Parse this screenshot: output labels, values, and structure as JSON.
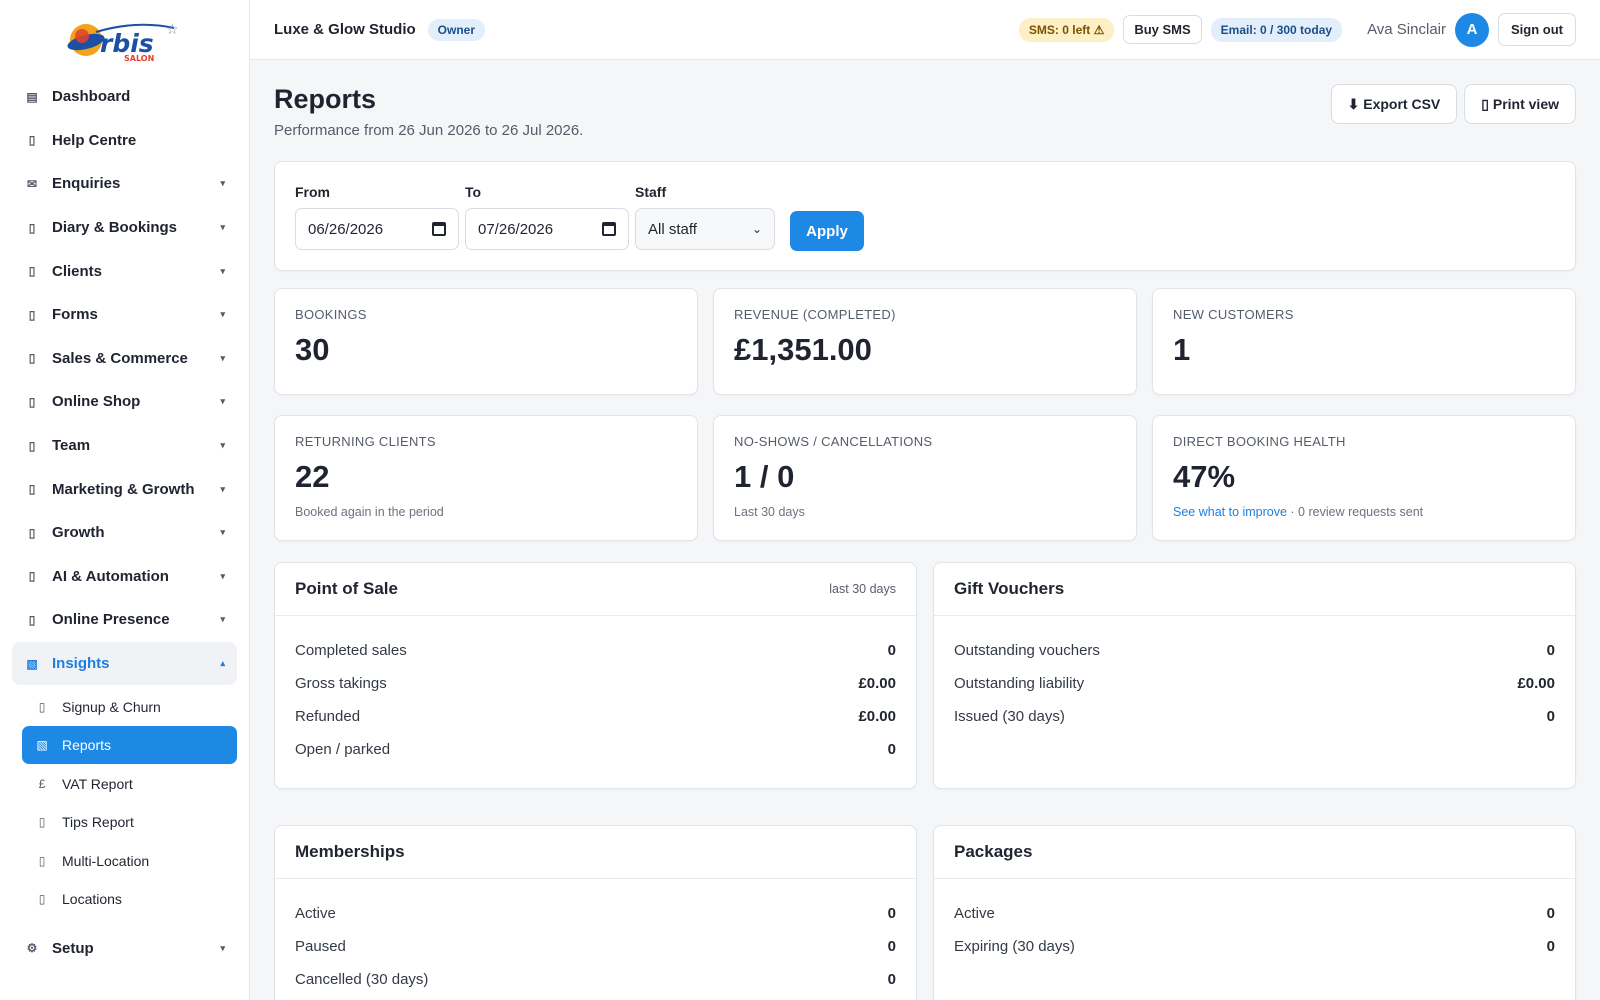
{
  "logo": {
    "text": "rbis",
    "subtitle": "SALON"
  },
  "sidebar": {
    "items": [
      {
        "label": "Dashboard",
        "icon": "grid-icon",
        "glyph": "▤",
        "chevron": ""
      },
      {
        "label": "Help Centre",
        "icon": "help-icon",
        "glyph": "▯",
        "chevron": ""
      },
      {
        "label": "Enquiries",
        "icon": "envelope-icon",
        "glyph": "✉",
        "chevron": "▾"
      },
      {
        "label": "Diary & Bookings",
        "icon": "calendar-icon",
        "glyph": "▯",
        "chevron": "▾"
      },
      {
        "label": "Clients",
        "icon": "users-icon",
        "glyph": "▯",
        "chevron": "▾"
      },
      {
        "label": "Forms",
        "icon": "form-icon",
        "glyph": "▯",
        "chevron": "▾"
      },
      {
        "label": "Sales & Commerce",
        "icon": "cart-icon",
        "glyph": "▯",
        "chevron": "▾"
      },
      {
        "label": "Online Shop",
        "icon": "shop-icon",
        "glyph": "▯",
        "chevron": "▾"
      },
      {
        "label": "Team",
        "icon": "team-icon",
        "glyph": "▯",
        "chevron": "▾"
      },
      {
        "label": "Marketing & Growth",
        "icon": "megaphone-icon",
        "glyph": "▯",
        "chevron": "▾"
      },
      {
        "label": "Growth",
        "icon": "growth-icon",
        "glyph": "▯",
        "chevron": "▾"
      },
      {
        "label": "AI & Automation",
        "icon": "robot-icon",
        "glyph": "▯",
        "chevron": "▾"
      },
      {
        "label": "Online Presence",
        "icon": "globe-icon",
        "glyph": "▯",
        "chevron": "▾"
      }
    ],
    "insights": {
      "label": "Insights",
      "glyph": "▧",
      "chevron": "▴"
    },
    "sub_items": [
      {
        "label": "Signup & Churn",
        "glyph": "▯"
      },
      {
        "label": "Reports",
        "glyph": "▧"
      },
      {
        "label": "VAT Report",
        "glyph": "£"
      },
      {
        "label": "Tips Report",
        "glyph": "▯"
      },
      {
        "label": "Multi-Location",
        "glyph": "▯"
      },
      {
        "label": "Locations",
        "glyph": "▯"
      }
    ],
    "setup": {
      "label": "Setup",
      "glyph": "⚙",
      "chevron": "▾"
    }
  },
  "topbar": {
    "brand": "Luxe & Glow Studio",
    "role": "Owner",
    "sms_status": "SMS: 0 left ⚠",
    "buy_sms": "Buy SMS",
    "email_status": "Email: 0 / 300 today",
    "user_name": "Ava Sinclair",
    "avatar_initial": "A",
    "sign_out": "Sign out"
  },
  "page": {
    "title": "Reports",
    "subtitle": "Performance from 26 Jun 2026 to 26 Jul 2026.",
    "export_csv": "⬇ Export CSV",
    "print_view": "▯ Print view"
  },
  "filters": {
    "from_label": "From",
    "from_value": "06/26/2026",
    "to_label": "To",
    "to_value": "07/26/2026",
    "staff_label": "Staff",
    "staff_value": "All staff",
    "apply": "Apply"
  },
  "stats": [
    {
      "label": "BOOKINGS",
      "value": "30",
      "note": ""
    },
    {
      "label": "REVENUE (COMPLETED)",
      "value": "£1,351.00",
      "note": ""
    },
    {
      "label": "NEW CUSTOMERS",
      "value": "1",
      "note": ""
    },
    {
      "label": "RETURNING CLIENTS",
      "value": "22",
      "note": "Booked again in the period"
    },
    {
      "label": "NO-SHOWS / CANCELLATIONS",
      "value": "1 / 0",
      "note": "Last 30 days"
    },
    {
      "label": "DIRECT BOOKING HEALTH",
      "value": "47%",
      "link": "See what to improve",
      "note": " · 0 review requests sent"
    }
  ],
  "panels": {
    "pos": {
      "title": "Point of Sale",
      "meta": "last 30 days",
      "rows": [
        {
          "label": "Completed sales",
          "value": "0"
        },
        {
          "label": "Gross takings",
          "value": "£0.00"
        },
        {
          "label": "Refunded",
          "value": "£0.00"
        },
        {
          "label": "Open / parked",
          "value": "0"
        }
      ]
    },
    "vouchers": {
      "title": "Gift Vouchers",
      "rows": [
        {
          "label": "Outstanding vouchers",
          "value": "0"
        },
        {
          "label": "Outstanding liability",
          "value": "£0.00"
        },
        {
          "label": "Issued (30 days)",
          "value": "0"
        }
      ]
    },
    "memberships": {
      "title": "Memberships",
      "rows": [
        {
          "label": "Active",
          "value": "0"
        },
        {
          "label": "Paused",
          "value": "0"
        },
        {
          "label": "Cancelled (30 days)",
          "value": "0"
        }
      ]
    },
    "packages": {
      "title": "Packages",
      "rows": [
        {
          "label": "Active",
          "value": "0"
        },
        {
          "label": "Expiring (30 days)",
          "value": "0"
        }
      ]
    }
  },
  "colors": {
    "accent": "#1e88e5",
    "sms_bg": "#fdf0c6",
    "pill_bg": "#e3eefb"
  }
}
